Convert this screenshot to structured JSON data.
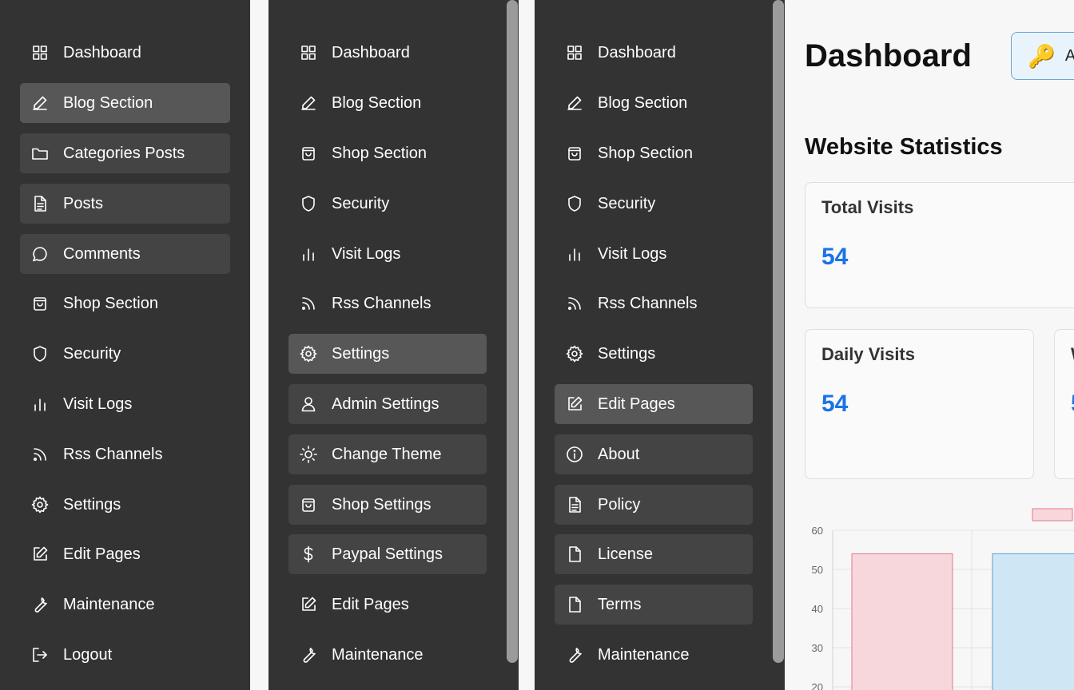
{
  "sidebar_1": {
    "items": [
      {
        "label": "Dashboard",
        "icon": "dashboard-icon"
      },
      {
        "label": "Blog Section",
        "icon": "pencil-icon"
      },
      {
        "label": "Categories Posts",
        "icon": "folder-icon"
      },
      {
        "label": "Posts",
        "icon": "document-icon"
      },
      {
        "label": "Comments",
        "icon": "comment-icon"
      },
      {
        "label": "Shop Section",
        "icon": "shopping-bag-icon"
      },
      {
        "label": "Security",
        "icon": "shield-icon"
      },
      {
        "label": "Visit Logs",
        "icon": "bar-chart-icon"
      },
      {
        "label": "Rss Channels",
        "icon": "rss-icon"
      },
      {
        "label": "Settings",
        "icon": "gear-icon"
      },
      {
        "label": "Edit Pages",
        "icon": "edit-icon"
      },
      {
        "label": "Maintenance",
        "icon": "wrench-icon"
      },
      {
        "label": "Logout",
        "icon": "logout-icon"
      }
    ]
  },
  "sidebar_2": {
    "items": [
      {
        "label": "Dashboard",
        "icon": "dashboard-icon"
      },
      {
        "label": "Blog Section",
        "icon": "pencil-icon"
      },
      {
        "label": "Shop Section",
        "icon": "shopping-bag-icon"
      },
      {
        "label": "Security",
        "icon": "shield-icon"
      },
      {
        "label": "Visit Logs",
        "icon": "bar-chart-icon"
      },
      {
        "label": "Rss Channels",
        "icon": "rss-icon"
      },
      {
        "label": "Settings",
        "icon": "gear-icon"
      },
      {
        "label": "Admin Settings",
        "icon": "user-icon"
      },
      {
        "label": "Change Theme",
        "icon": "sun-icon"
      },
      {
        "label": "Shop Settings",
        "icon": "shopping-bag-icon"
      },
      {
        "label": "Paypal Settings",
        "icon": "dollar-icon"
      },
      {
        "label": "Edit Pages",
        "icon": "edit-icon"
      },
      {
        "label": "Maintenance",
        "icon": "wrench-icon"
      }
    ]
  },
  "sidebar_3": {
    "items": [
      {
        "label": "Dashboard",
        "icon": "dashboard-icon"
      },
      {
        "label": "Blog Section",
        "icon": "pencil-icon"
      },
      {
        "label": "Shop Section",
        "icon": "shopping-bag-icon"
      },
      {
        "label": "Security",
        "icon": "shield-icon"
      },
      {
        "label": "Visit Logs",
        "icon": "bar-chart-icon"
      },
      {
        "label": "Rss Channels",
        "icon": "rss-icon"
      },
      {
        "label": "Settings",
        "icon": "gear-icon"
      },
      {
        "label": "Edit Pages",
        "icon": "edit-icon"
      },
      {
        "label": "About",
        "icon": "info-icon"
      },
      {
        "label": "Policy",
        "icon": "document-icon"
      },
      {
        "label": "License",
        "icon": "file-icon"
      },
      {
        "label": "Terms",
        "icon": "file-icon"
      },
      {
        "label": "Maintenance",
        "icon": "wrench-icon"
      }
    ]
  },
  "main": {
    "title": "Dashboard",
    "admin_button_label": "A",
    "section_title": "Website Statistics",
    "cards": [
      {
        "label": "Total Visits",
        "value": "54"
      },
      {
        "label": "Daily Visits",
        "value": "54"
      },
      {
        "label": "W",
        "value": "5"
      }
    ]
  },
  "colors": {
    "sidebar_bg": "#333333",
    "submenu_bg": "#444444",
    "active_bg": "#575757",
    "stat_value": "#1a73e8",
    "bar_pink": "#f8d7dc",
    "bar_blue": "#cfe6f5"
  },
  "chart_data": {
    "type": "bar",
    "categories": [
      "",
      ""
    ],
    "values": [
      54,
      54
    ],
    "ylim": [
      20,
      60
    ],
    "yticks": [
      60,
      50,
      40,
      30,
      20
    ],
    "grid": true,
    "legend": "top"
  }
}
